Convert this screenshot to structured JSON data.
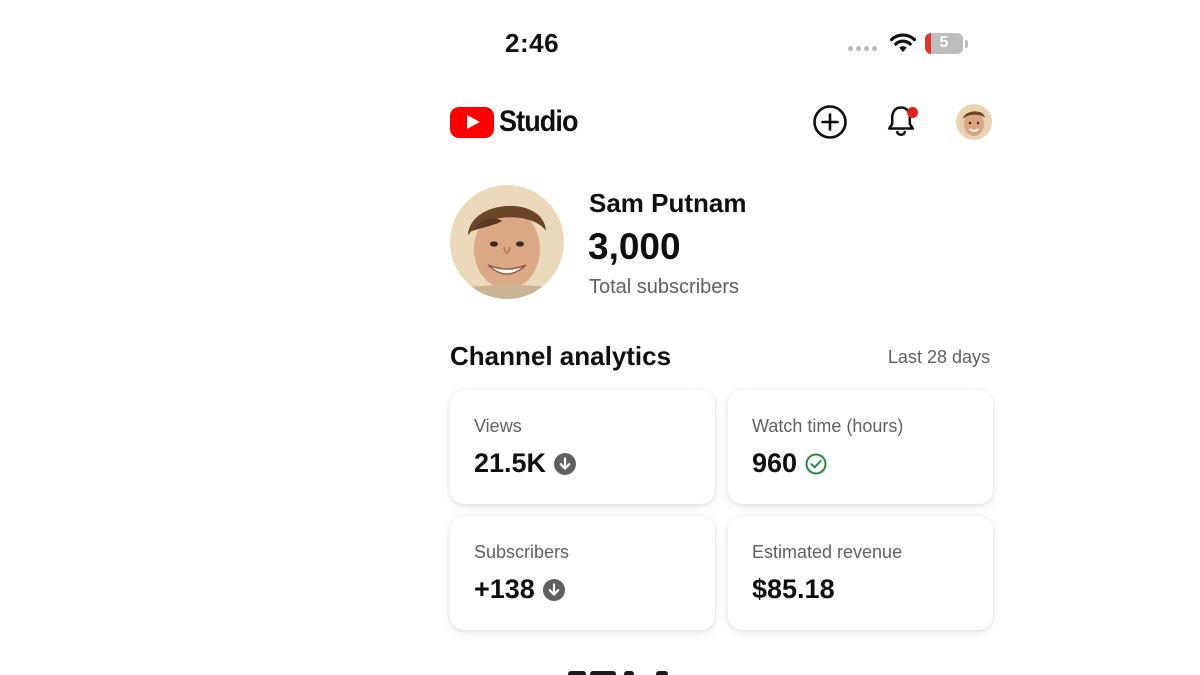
{
  "status_bar": {
    "time": "2:46",
    "battery_level": "5",
    "icons": [
      "cellular-signal-icon",
      "wifi-icon",
      "battery-icon"
    ]
  },
  "header": {
    "logo_text": "Studio",
    "icons": [
      "youtube-play-icon",
      "create-icon",
      "notifications-bell-icon",
      "account-avatar"
    ],
    "notification_badge_color": "#e62117"
  },
  "channel": {
    "name": "Sam Putnam",
    "subscriber_count": "3,000",
    "subscriber_label": "Total subscribers"
  },
  "analytics": {
    "title": "Channel analytics",
    "period": "Last 28 days",
    "cards": [
      {
        "label": "Views",
        "value": "21.5K",
        "trend_icon": "arrow-down-circle-icon"
      },
      {
        "label": "Watch time (hours)",
        "value": "960",
        "trend_icon": "check-circle-icon"
      },
      {
        "label": "Subscribers",
        "value": "+138",
        "trend_icon": "arrow-down-circle-icon"
      },
      {
        "label": "Estimated revenue",
        "value": "$85.18",
        "trend_icon": ""
      }
    ]
  },
  "colors": {
    "brand_red": "#ff0000",
    "text_primary": "#0f0f0f",
    "text_secondary": "#606060",
    "trend_down": "#606060",
    "trend_ok": "#1f8a3a"
  }
}
